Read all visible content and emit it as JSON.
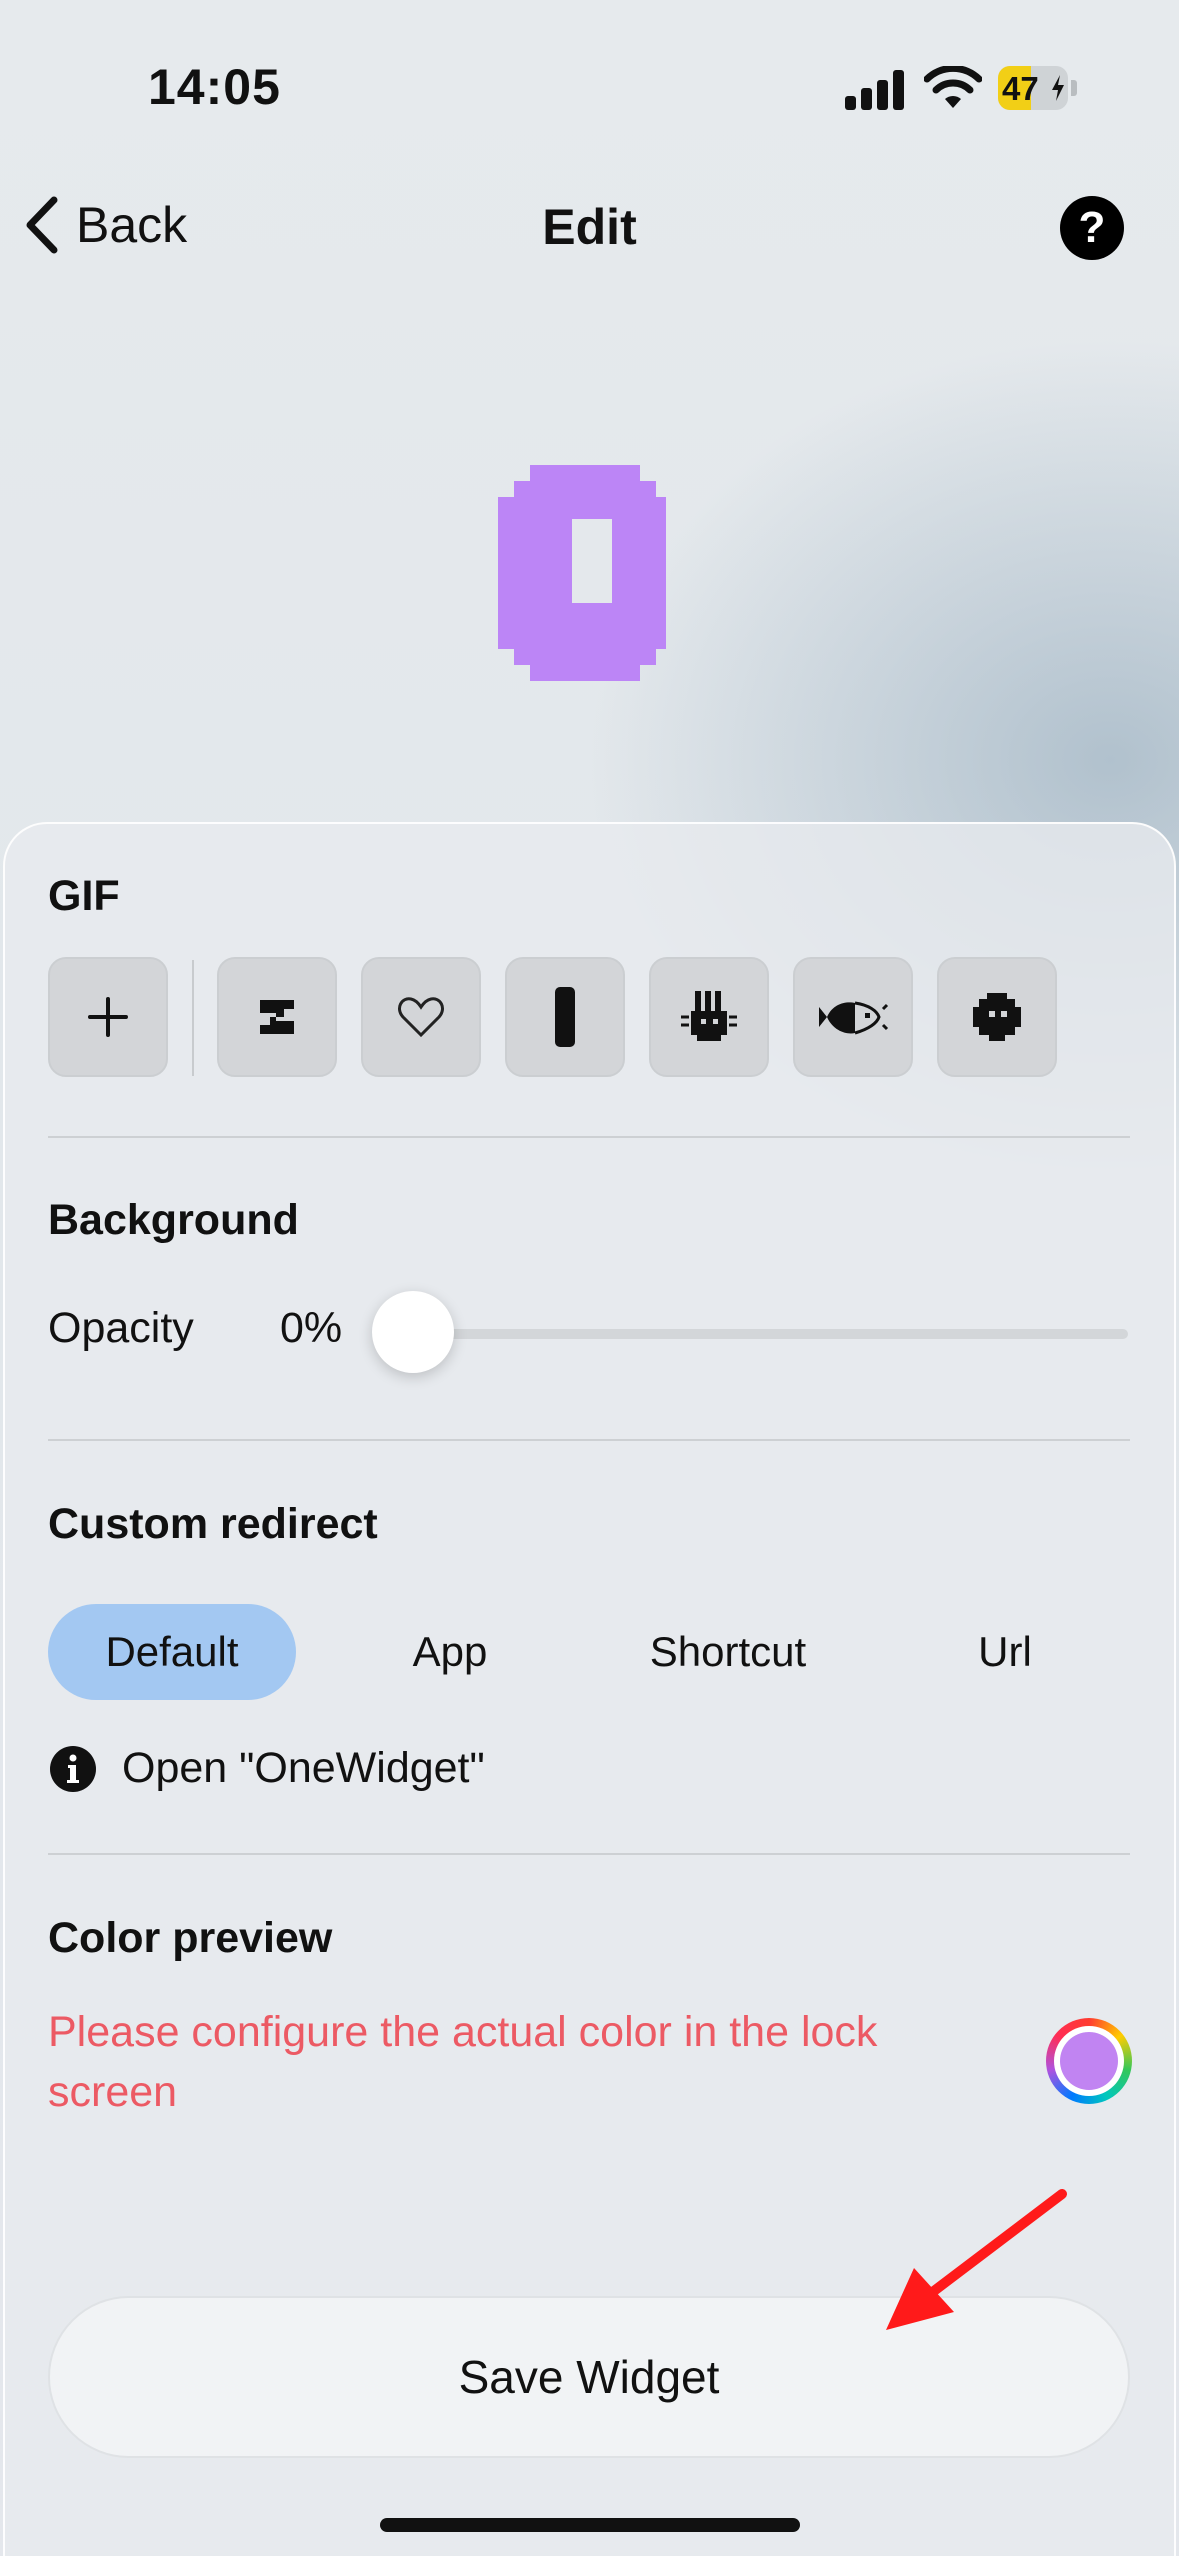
{
  "status": {
    "time": "14:05",
    "battery": "47",
    "battery_level": 0.47
  },
  "nav": {
    "back_label": "Back",
    "title": "Edit",
    "help_label": "?"
  },
  "gif": {
    "section_title": "GIF",
    "tiles": [
      {
        "name": "add-icon"
      },
      {
        "name": "sleep-z-icon"
      },
      {
        "name": "heart-outline-icon"
      },
      {
        "name": "pill-bar-icon"
      },
      {
        "name": "cat-icon"
      },
      {
        "name": "fish-icon"
      },
      {
        "name": "chick-icon"
      }
    ]
  },
  "background": {
    "section_title": "Background",
    "opacity_label": "Opacity",
    "opacity_value": "0%",
    "opacity_level": 0
  },
  "redirect": {
    "section_title": "Custom redirect",
    "options": [
      "Default",
      "App",
      "Shortcut",
      "Url"
    ],
    "selected": "Default",
    "info_text": "Open \"OneWidget\""
  },
  "color_preview": {
    "section_title": "Color preview",
    "warning": "Please configure the actual color in the lock screen",
    "swatch_color": "#c184f2"
  },
  "save_label": "Save Widget",
  "colors": {
    "accent": "#a3c8f2",
    "warning": "#ec5a64",
    "preview_purple": "#bc85f6",
    "annotation_red": "#ff1a1a"
  }
}
